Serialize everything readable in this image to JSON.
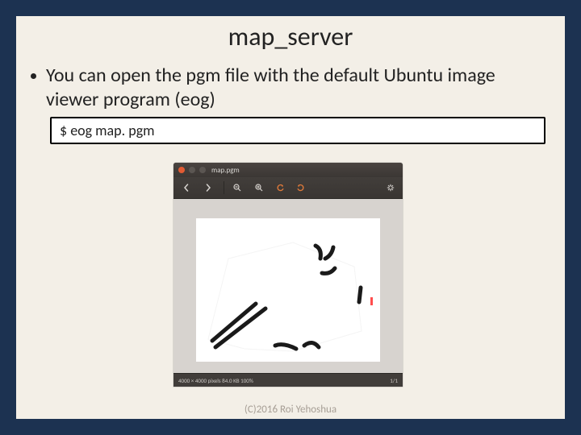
{
  "title": "map_server",
  "bullet_text": "You can open the pgm file with the default Ubuntu image viewer program (eog)",
  "command": "$ eog map. pgm",
  "eog": {
    "title": "map.pgm",
    "toolbar": {
      "prev": "",
      "next": "",
      "zoom_out": "",
      "zoom_in": ""
    },
    "status_left": "4000 × 4000 pixels  84.0 KB  100%",
    "status_right": "1/1"
  },
  "footer": "(C)2016 Roi Yehoshua"
}
